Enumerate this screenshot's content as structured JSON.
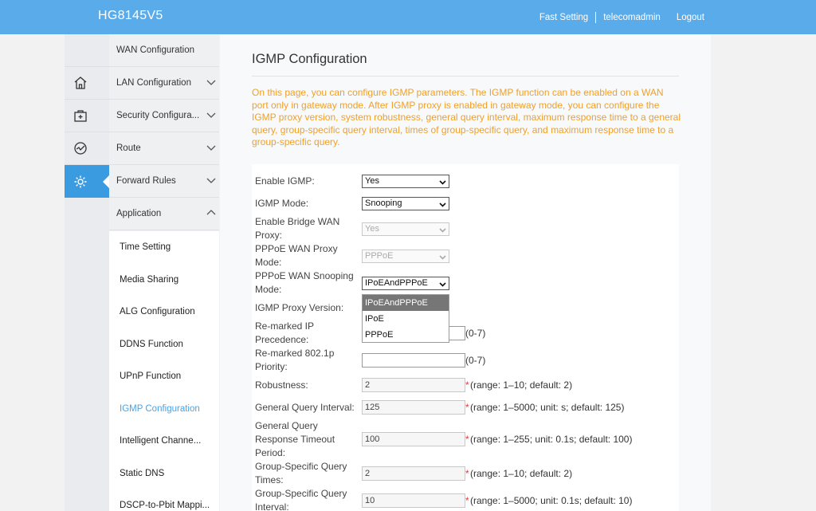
{
  "header": {
    "brand": "HG8145V5",
    "links": {
      "fast_setting": "Fast Setting",
      "user": "telecomadmin",
      "logout": "Logout"
    }
  },
  "rail": {
    "icons": [
      "home-icon",
      "security-kit-icon",
      "route-graph-icon",
      "gear-icon"
    ]
  },
  "menu": {
    "items": [
      {
        "label": "WAN Configuration"
      },
      {
        "label": "LAN Configuration"
      },
      {
        "label": "Security Configura..."
      },
      {
        "label": "Route"
      },
      {
        "label": "Forward Rules"
      },
      {
        "label": "Application"
      }
    ],
    "subitems": [
      {
        "label": "Time Setting"
      },
      {
        "label": "Media Sharing"
      },
      {
        "label": "ALG Configuration"
      },
      {
        "label": "DDNS Function"
      },
      {
        "label": "UPnP Function"
      },
      {
        "label": "IGMP Configuration"
      },
      {
        "label": "Intelligent Channe..."
      },
      {
        "label": "Static DNS"
      },
      {
        "label": "DSCP-to-Pbit Mappi..."
      }
    ]
  },
  "content": {
    "title": "IGMP Configuration",
    "description": "On this page, you can configure IGMP parameters. The IGMP function can be enabled on a WAN port only in gateway mode. After IGMP proxy is enabled in gateway mode, you can configure the IGMP proxy version, system robustness, general query interval, maximum response time to a general query, group-specific query interval, times of group-specific query, and maximum response time to a group-specific query."
  },
  "form": {
    "enable_igmp": {
      "label": "Enable IGMP:",
      "value": "Yes"
    },
    "igmp_mode": {
      "label": "IGMP Mode:",
      "value": "Snooping"
    },
    "bridge_wan_proxy": {
      "label": "Enable Bridge WAN Proxy:",
      "value": "Yes"
    },
    "pppoe_wan_proxy_mode": {
      "label": "PPPoE WAN Proxy Mode:",
      "value": "PPPoE"
    },
    "pppoe_wan_snooping_mode": {
      "label": "PPPoE WAN Snooping Mode:",
      "value": "IPoEAndPPPoE",
      "options": [
        "IPoEAndPPPoE",
        "IPoE",
        "PPPoE"
      ]
    },
    "igmp_proxy_version": {
      "label": "IGMP Proxy Version:"
    },
    "remarked_ip_precedence": {
      "label": "Re-marked IP Precedence:",
      "value": "",
      "hint": "(0-7)"
    },
    "remarked_8021p": {
      "label": "Re-marked 802.1p Priority:",
      "value": "",
      "hint": "(0-7)"
    },
    "robustness": {
      "label": "Robustness:",
      "value": "2",
      "hint": "(range: 1–10; default: 2)"
    },
    "general_query_interval": {
      "label": "General Query Interval:",
      "value": "125",
      "hint": "(range: 1–5000; unit: s; default: 125)"
    },
    "general_query_timeout": {
      "label": "General Query Response Timeout Period:",
      "value": "100",
      "hint": "(range: 1–255; unit: 0.1s; default: 100)"
    },
    "group_query_times": {
      "label": "Group-Specific Query Times:",
      "value": "2",
      "hint": "(range: 1–10; default: 2)"
    },
    "group_query_interval": {
      "label": "Group-Specific Query Interval:",
      "value": "10",
      "hint": "(range: 1–5000; unit: 0.1s; default: 10)"
    },
    "required_mark": "*"
  }
}
